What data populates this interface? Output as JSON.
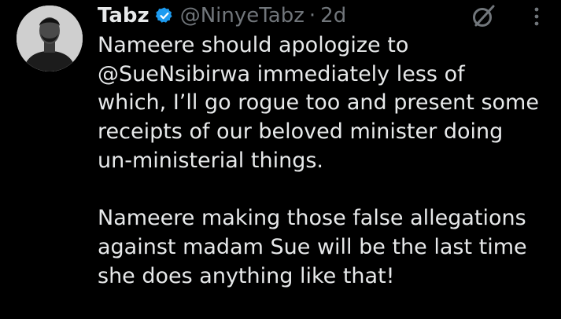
{
  "author": {
    "display_name": "Tabz",
    "handle": "@NinyeTabz",
    "separator": "·",
    "time": "2d",
    "verified_icon": "verified-badge-icon"
  },
  "actions": {
    "grok_icon": "grok-icon",
    "more_icon": "more-options-icon"
  },
  "tweet": {
    "paragraph_1_lines": [
      "Nameere should apologize to",
      "@SueNsibirwa immediately less of",
      "which, I’ll go rogue too and present some",
      "receipts of our beloved minister doing",
      "un-ministerial things."
    ],
    "paragraph_2_lines": [
      "Nameere making those false allegations",
      "against madam Sue will be the last time",
      "she does anything like that!"
    ]
  },
  "colors": {
    "background": "#000000",
    "primary_text": "#e7e9ea",
    "secondary_text": "#71767b",
    "verified_blue": "#1d9bf0"
  }
}
